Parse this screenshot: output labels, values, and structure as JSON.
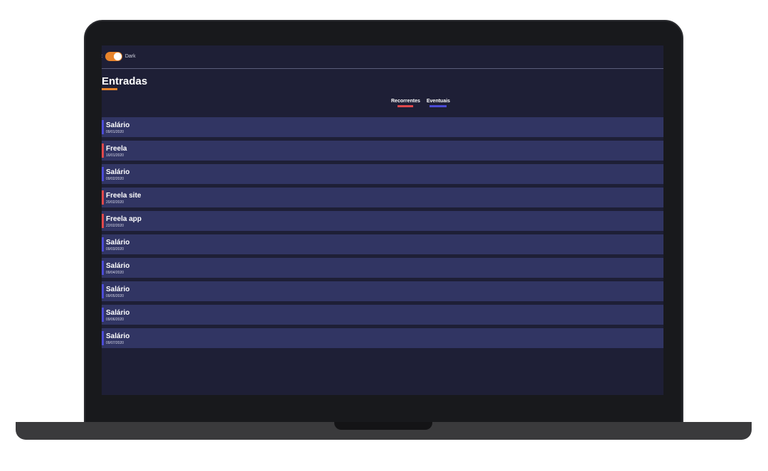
{
  "toggle": {
    "light_label": "ht",
    "dark_label": "Dark"
  },
  "page": {
    "title": "Entradas"
  },
  "legend": [
    {
      "label": "Recorrentes",
      "color": "#e0484c"
    },
    {
      "label": "Eventuais",
      "color": "#4c4cd6"
    }
  ],
  "entries": [
    {
      "name": "Salário",
      "date": "09/01/2020",
      "type": "recorrente"
    },
    {
      "name": "Freela",
      "date": "16/01/2020",
      "type": "eventual"
    },
    {
      "name": "Salário",
      "date": "09/02/2020",
      "type": "recorrente"
    },
    {
      "name": "Freela site",
      "date": "20/02/2020",
      "type": "eventual"
    },
    {
      "name": "Freela app",
      "date": "22/02/2020",
      "type": "eventual"
    },
    {
      "name": "Salário",
      "date": "09/03/2020",
      "type": "recorrente"
    },
    {
      "name": "Salário",
      "date": "09/04/2020",
      "type": "recorrente"
    },
    {
      "name": "Salário",
      "date": "09/05/2020",
      "type": "recorrente"
    },
    {
      "name": "Salário",
      "date": "09/06/2020",
      "type": "recorrente"
    },
    {
      "name": "Salário",
      "date": "09/07/2020",
      "type": "recorrente"
    }
  ],
  "colors": {
    "recorrente_marker": "#4c4cd6",
    "eventual_marker": "#e0484c",
    "accent": "#e8842b"
  }
}
